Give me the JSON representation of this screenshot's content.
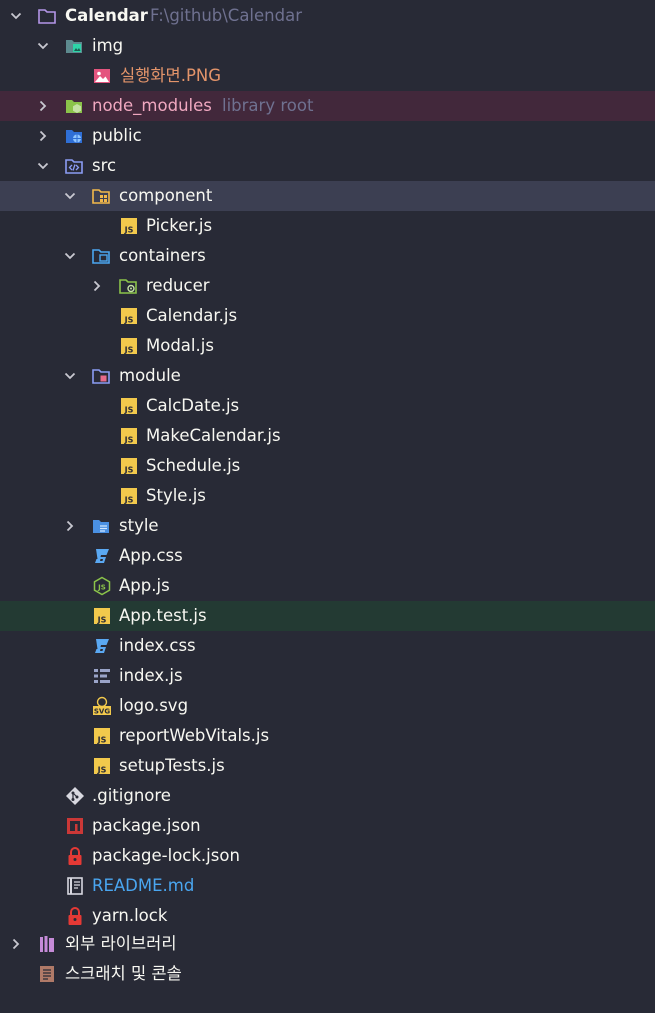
{
  "project": {
    "name": "Calendar",
    "path": "F:\\github\\Calendar"
  },
  "rows": [
    {
      "label": "img"
    },
    {
      "label": "실행화면.PNG"
    },
    {
      "label": "node_modules",
      "hint": "library root"
    },
    {
      "label": "public"
    },
    {
      "label": "src"
    },
    {
      "label": "component"
    },
    {
      "label": "Picker.js"
    },
    {
      "label": "containers"
    },
    {
      "label": "reducer"
    },
    {
      "label": "Calendar.js"
    },
    {
      "label": "Modal.js"
    },
    {
      "label": "module"
    },
    {
      "label": "CalcDate.js"
    },
    {
      "label": "MakeCalendar.js"
    },
    {
      "label": "Schedule.js"
    },
    {
      "label": "Style.js"
    },
    {
      "label": "style"
    },
    {
      "label": "App.css"
    },
    {
      "label": "App.js"
    },
    {
      "label": "App.test.js"
    },
    {
      "label": "index.css"
    },
    {
      "label": "index.js"
    },
    {
      "label": "logo.svg"
    },
    {
      "label": "reportWebVitals.js"
    },
    {
      "label": "setupTests.js"
    },
    {
      "label": ".gitignore"
    },
    {
      "label": "package.json"
    },
    {
      "label": "package-lock.json"
    },
    {
      "label": "README.md"
    },
    {
      "label": "yarn.lock"
    }
  ],
  "bottom": {
    "external_libraries": "외부 라이브러리",
    "scratches": "스크래치 및 콘솔"
  },
  "colors": {
    "background": "#282a36",
    "selected_row": "#3c3f52",
    "library_row": "#42283b",
    "test_row": "#233a33",
    "text": "#f8f8f2",
    "hint": "#6f7190",
    "image_file": "#e3946a",
    "readme": "#4aa6f0",
    "js_icon": "#f2c94c"
  },
  "icons": {
    "folder": "folder-icon",
    "image_folder": "image-folder-icon",
    "node_folder": "node-folder-icon",
    "web_folder": "web-folder-icon",
    "source_folder": "source-folder-icon",
    "component_folder": "component-folder-icon",
    "container_folder": "container-folder-icon",
    "reducer_folder": "reducer-folder-icon",
    "module_folder": "module-folder-icon",
    "style_folder": "style-folder-icon",
    "js_file": "js-file-icon",
    "css_file": "css-file-icon",
    "node_js_file": "nodejs-file-icon",
    "index_file": "index-file-icon",
    "svg_file": "svg-file-icon",
    "git_file": "git-icon",
    "npm_file": "npm-icon",
    "lock_file": "lock-icon",
    "readme_file": "readme-icon",
    "library": "library-icon",
    "scratch": "scratch-icon"
  }
}
